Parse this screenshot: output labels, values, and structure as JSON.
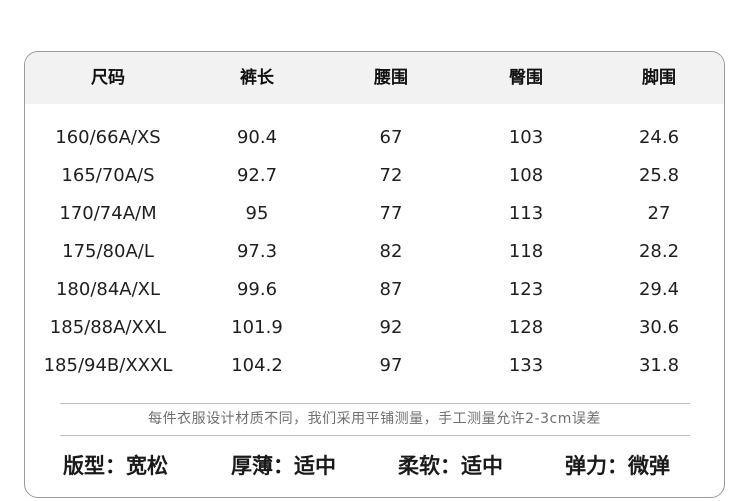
{
  "table": {
    "headers": [
      "尺码",
      "裤长",
      "腰围",
      "臀围",
      "脚围"
    ],
    "rows": [
      [
        "160/66A/XS",
        "90.4",
        "67",
        "103",
        "24.6"
      ],
      [
        "165/70A/S",
        "92.7",
        "72",
        "108",
        "25.8"
      ],
      [
        "170/74A/M",
        "95",
        "77",
        "113",
        "27"
      ],
      [
        "175/80A/L",
        "97.3",
        "82",
        "118",
        "28.2"
      ],
      [
        "180/84A/XL",
        "99.6",
        "87",
        "123",
        "29.4"
      ],
      [
        "185/88A/XXL",
        "101.9",
        "92",
        "128",
        "30.6"
      ],
      [
        "185/94B/XXXL",
        "104.2",
        "97",
        "133",
        "31.8"
      ]
    ]
  },
  "note": "每件衣服设计材质不同，我们采用平铺测量，手工测量允许2-3cm误差",
  "properties": [
    "版型：宽松",
    "厚薄：适中",
    "柔软：适中",
    "弹力：微弹"
  ]
}
